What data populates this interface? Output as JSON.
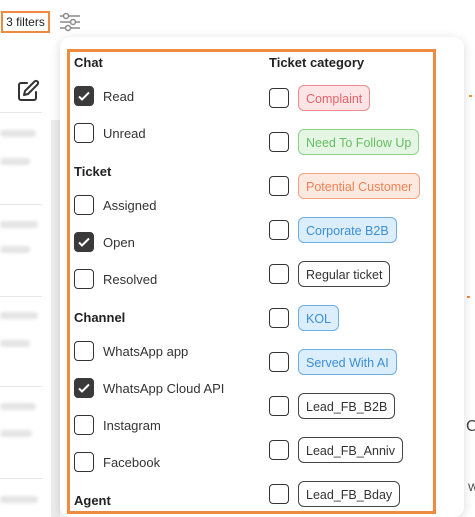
{
  "toolbar": {
    "filter_count": "3 filters"
  },
  "filters": {
    "chat": {
      "title": "Chat",
      "options": [
        {
          "label": "Read",
          "checked": true
        },
        {
          "label": "Unread",
          "checked": false
        }
      ]
    },
    "ticket": {
      "title": "Ticket",
      "options": [
        {
          "label": "Assigned",
          "checked": false
        },
        {
          "label": "Open",
          "checked": true
        },
        {
          "label": "Resolved",
          "checked": false
        }
      ]
    },
    "channel": {
      "title": "Channel",
      "options": [
        {
          "label": "WhatsApp app",
          "checked": false
        },
        {
          "label": "WhatsApp Cloud API",
          "checked": true
        },
        {
          "label": "Instagram",
          "checked": false
        },
        {
          "label": "Facebook",
          "checked": false
        }
      ]
    },
    "agent": {
      "title": "Agent"
    },
    "ticket_category": {
      "title": "Ticket category",
      "options": [
        {
          "label": "Complaint",
          "checked": false,
          "text_color": "#e5646b",
          "bg": "#fde5e6",
          "border": "#ef8c92"
        },
        {
          "label": "Need To Follow Up",
          "checked": false,
          "text_color": "#66bf63",
          "bg": "#e6f6e4",
          "border": "#8ed38a"
        },
        {
          "label": "Potential Customer",
          "checked": false,
          "text_color": "#ef8257",
          "bg": "#fde9df",
          "border": "#f2a27f"
        },
        {
          "label": "Corporate B2B",
          "checked": false,
          "text_color": "#3b8fd6",
          "bg": "#dcedfb",
          "border": "#6aaee4"
        },
        {
          "label": "Regular ticket",
          "checked": false,
          "text_color": "#333333",
          "bg": "#ffffff",
          "border": "#444444"
        },
        {
          "label": "KOL",
          "checked": false,
          "text_color": "#3b8fd6",
          "bg": "#dcedfb",
          "border": "#6aaee4"
        },
        {
          "label": "Served With AI",
          "checked": false,
          "text_color": "#3b8fd6",
          "bg": "#dcedfb",
          "border": "#6aaee4"
        },
        {
          "label": "Lead_FB_B2B",
          "checked": false,
          "text_color": "#333333",
          "bg": "#ffffff",
          "border": "#444444"
        },
        {
          "label": "Lead_FB_Anniv",
          "checked": false,
          "text_color": "#333333",
          "bg": "#ffffff",
          "border": "#444444"
        },
        {
          "label": "Lead_FB_Bday",
          "checked": false,
          "text_color": "#333333",
          "bg": "#ffffff",
          "border": "#444444"
        }
      ]
    }
  },
  "icons": {
    "filter": "sliders-icon",
    "edit": "edit-icon",
    "check": "checkmark-icon"
  },
  "background": {
    "glyph_c": "C",
    "glyph_w": "W"
  }
}
